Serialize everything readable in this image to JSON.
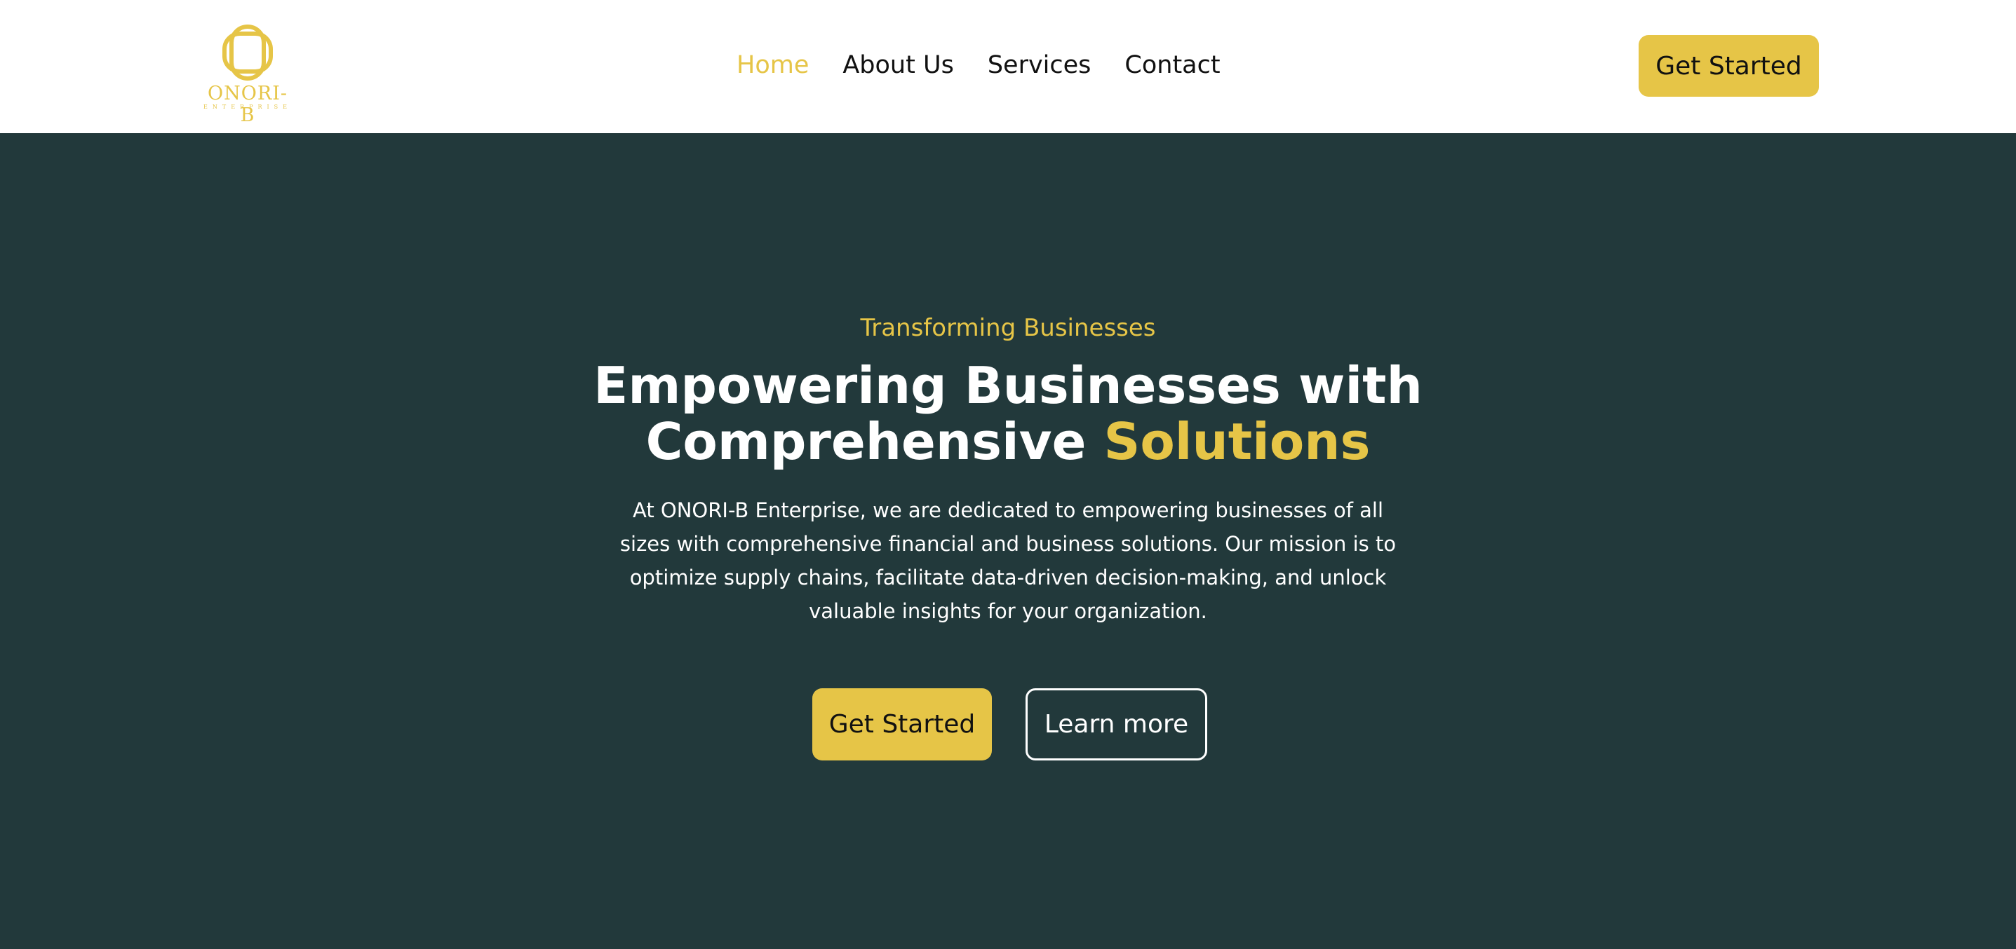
{
  "brand": {
    "name": "ONORI-B",
    "tagline": "ENTERPRISE",
    "color": "#E6C547",
    "logo_icon": "interlocked-rings-logo-icon"
  },
  "nav": {
    "items": [
      {
        "label": "Home",
        "active": true
      },
      {
        "label": "About Us",
        "active": false
      },
      {
        "label": "Services",
        "active": false
      },
      {
        "label": "Contact",
        "active": false
      }
    ],
    "cta_label": "Get Started"
  },
  "hero": {
    "eyebrow": "Transforming Businesses",
    "title_line1": "Empowering Businesses with",
    "title_line2_prefix": "Comprehensive ",
    "title_line2_accent": "Solutions",
    "description": "At ONORI-B Enterprise, we are dedicated to empowering businesses of all sizes with comprehensive financial and business solutions. Our mission is to optimize supply chains, facilitate data-driven decision-making, and unlock valuable insights for your organization.",
    "primary_button": "Get Started",
    "secondary_button": "Learn more"
  },
  "colors": {
    "header_bg": "#FFFFFF",
    "hero_bg": "#22393B",
    "accent": "#E6C547",
    "text_dark": "#111111",
    "text_light": "#FFFFFF"
  }
}
